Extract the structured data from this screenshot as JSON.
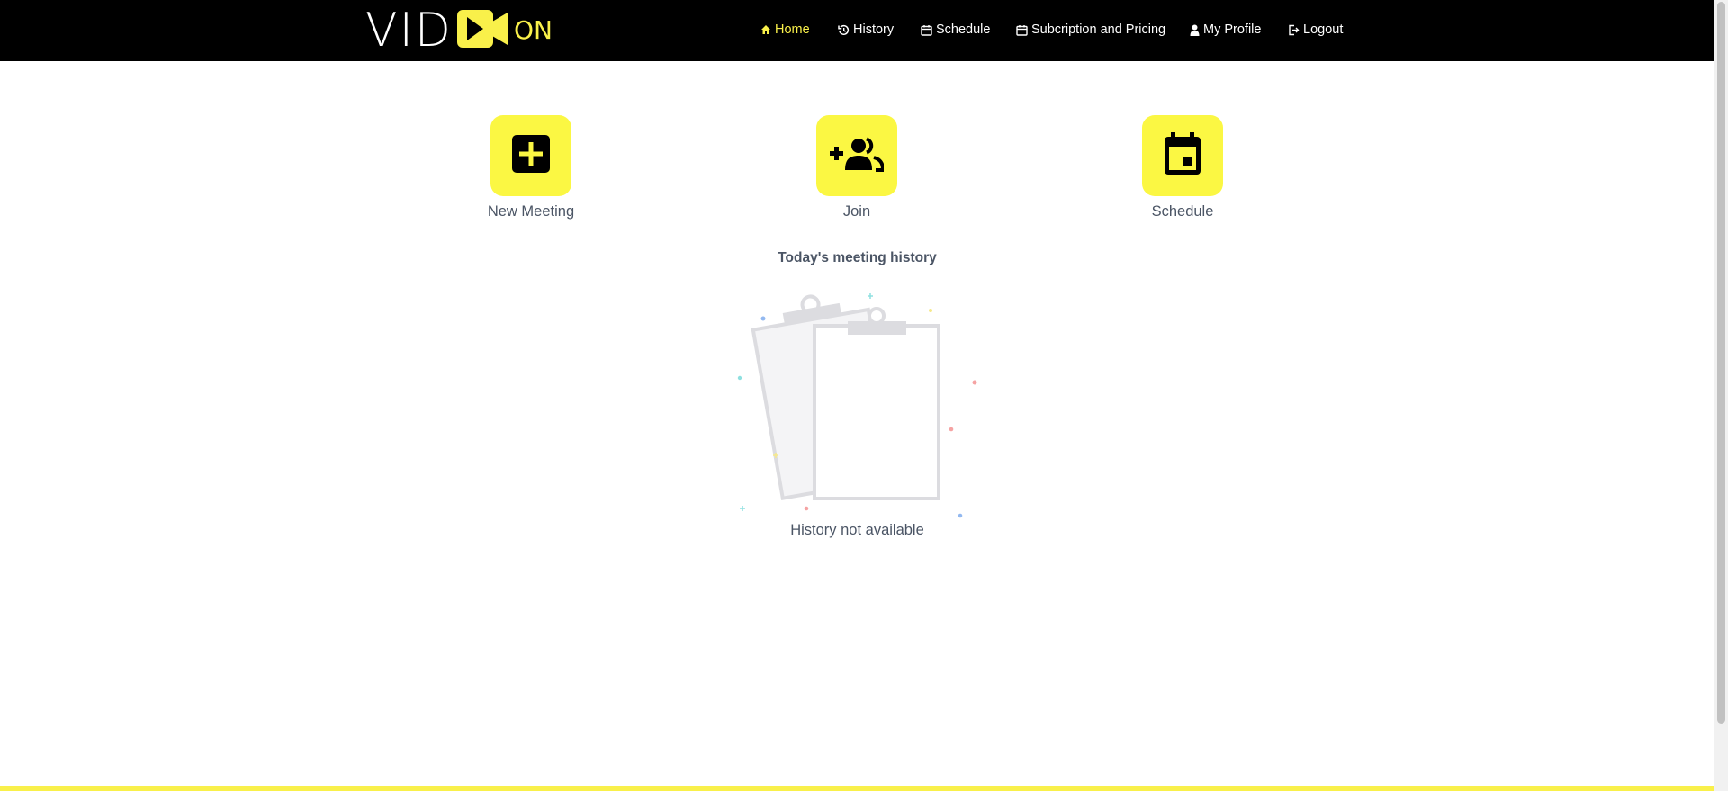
{
  "brand": {
    "logo_text_left": "VID",
    "logo_text_right": "ON",
    "accent_color": "#f9f04a"
  },
  "nav": {
    "items": [
      {
        "label": "Home",
        "icon": "home-icon",
        "active": true
      },
      {
        "label": "History",
        "icon": "history-icon",
        "active": false
      },
      {
        "label": "Schedule",
        "icon": "calendar-icon",
        "active": false
      },
      {
        "label": "Subcription and Pricing",
        "icon": "calendar-icon",
        "active": false
      },
      {
        "label": "My Profile",
        "icon": "user-icon",
        "active": false
      },
      {
        "label": "Logout",
        "icon": "logout-icon",
        "active": false
      }
    ]
  },
  "actions": [
    {
      "label": "New Meeting",
      "icon": "plus-square-icon"
    },
    {
      "label": "Join",
      "icon": "add-group-icon"
    },
    {
      "label": "Schedule",
      "icon": "calendar-event-icon"
    }
  ],
  "history": {
    "title": "Today's meeting history",
    "empty_text": "History not available",
    "empty_icon": "empty-clipboard-icon"
  }
}
